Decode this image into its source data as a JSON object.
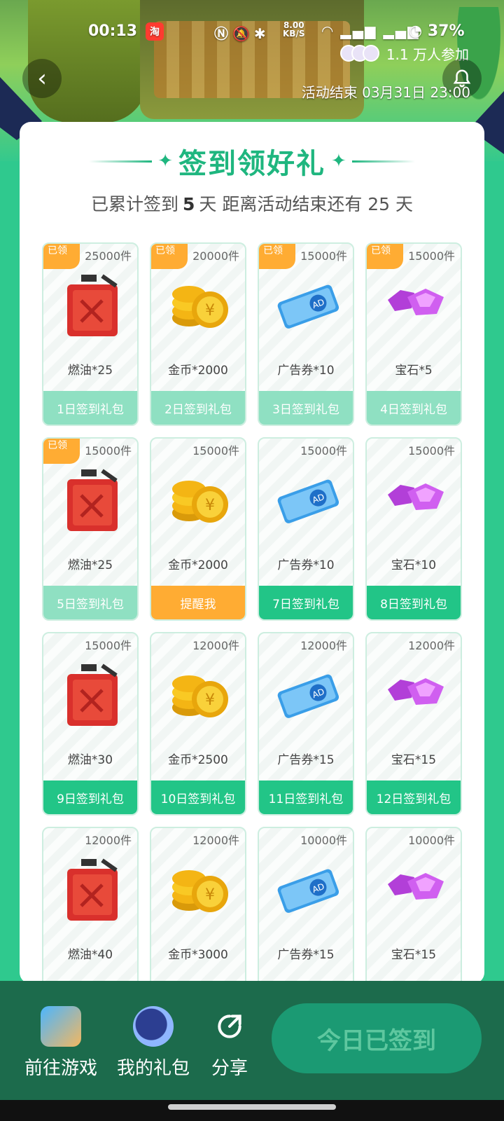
{
  "status_bar": {
    "time": "00:13",
    "app_badge": "淘",
    "speed_value": "8.00",
    "speed_unit": "KB/S",
    "battery": "37%"
  },
  "header": {
    "participants": "1.1 万人参加",
    "end_time": "活动结束 03月31日 23:00"
  },
  "card": {
    "title": "签到领好礼",
    "subtitle_prefix": "已累计签到",
    "signed_days": "5",
    "subtitle_mid": "天  距离活动结束还有 25 天"
  },
  "claim_tag": "已领",
  "tiles": [
    {
      "count": "25000件",
      "item": "燃油*25",
      "button": "1日签到礼包",
      "state": "claimed",
      "icon": "fuel-can-icon"
    },
    {
      "count": "20000件",
      "item": "金币*2000",
      "button": "2日签到礼包",
      "state": "claimed",
      "icon": "gold-coins-icon"
    },
    {
      "count": "15000件",
      "item": "广告券*10",
      "button": "3日签到礼包",
      "state": "claimed",
      "icon": "ad-ticket-icon"
    },
    {
      "count": "15000件",
      "item": "宝石*5",
      "button": "4日签到礼包",
      "state": "claimed",
      "icon": "gem-icon"
    },
    {
      "count": "15000件",
      "item": "燃油*25",
      "button": "5日签到礼包",
      "state": "claimed",
      "icon": "fuel-can-icon"
    },
    {
      "count": "15000件",
      "item": "金币*2000",
      "button": "提醒我",
      "state": "remind",
      "icon": "gold-coins-icon"
    },
    {
      "count": "15000件",
      "item": "广告券*10",
      "button": "7日签到礼包",
      "state": "active",
      "icon": "ad-ticket-icon"
    },
    {
      "count": "15000件",
      "item": "宝石*10",
      "button": "8日签到礼包",
      "state": "active",
      "icon": "gem-icon"
    },
    {
      "count": "15000件",
      "item": "燃油*30",
      "button": "9日签到礼包",
      "state": "active",
      "icon": "fuel-can-icon"
    },
    {
      "count": "12000件",
      "item": "金币*2500",
      "button": "10日签到礼包",
      "state": "active",
      "icon": "gold-coins-icon"
    },
    {
      "count": "12000件",
      "item": "广告券*15",
      "button": "11日签到礼包",
      "state": "active",
      "icon": "ad-ticket-icon"
    },
    {
      "count": "12000件",
      "item": "宝石*15",
      "button": "12日签到礼包",
      "state": "active",
      "icon": "gem-icon"
    },
    {
      "count": "12000件",
      "item": "燃油*40",
      "button": "",
      "state": "active",
      "icon": "fuel-can-icon"
    },
    {
      "count": "12000件",
      "item": "金币*3000",
      "button": "",
      "state": "active",
      "icon": "gold-coins-icon"
    },
    {
      "count": "10000件",
      "item": "广告券*15",
      "button": "",
      "state": "active",
      "icon": "ad-ticket-icon"
    },
    {
      "count": "10000件",
      "item": "宝石*15",
      "button": "",
      "state": "active",
      "icon": "gem-icon"
    }
  ],
  "bottom_bar": {
    "game_label": "前往游戏",
    "gifts_label": "我的礼包",
    "share_label": "分享",
    "signed_button": "今日已签到"
  },
  "colors": {
    "accent": "#1fb67f",
    "claimed": "#8fe0c2",
    "remind": "#ffac33",
    "bottom_bar": "#1c6b4c"
  }
}
